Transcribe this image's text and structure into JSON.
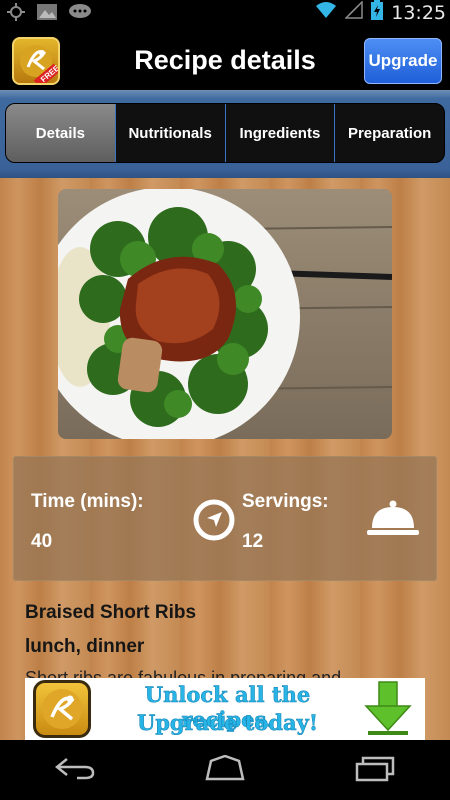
{
  "status_bar": {
    "time": "13:25",
    "icons": [
      "gps-icon",
      "image-icon",
      "message-icon",
      "wifi-icon",
      "signal-icon",
      "battery-icon"
    ]
  },
  "header": {
    "title": "Recipe details",
    "upgrade_label": "Upgrade",
    "logo_badge": "FREE"
  },
  "tabs": [
    {
      "label": "Details",
      "active": true
    },
    {
      "label": "Nutritionals",
      "active": false
    },
    {
      "label": "Ingredients",
      "active": false
    },
    {
      "label": "Preparation",
      "active": false
    }
  ],
  "info": {
    "time_label": "Time (mins):",
    "time_value": "40",
    "servings_label": "Servings:",
    "servings_value": "12",
    "time_icon": "compass-icon",
    "servings_icon": "cloche-icon"
  },
  "recipe": {
    "name": "Braised Short Ribs",
    "meals": "lunch, dinner",
    "description": "Short ribs are fabulous in preparing and"
  },
  "ad": {
    "line1": "Unlock all the recipes.",
    "line2": "Upgrade today!"
  },
  "colors": {
    "accent_blue": "#2f6fd8",
    "tab_divider": "#3c72c3",
    "ad_text": "#29b4e6",
    "ad_arrow": "#5ec02a"
  }
}
